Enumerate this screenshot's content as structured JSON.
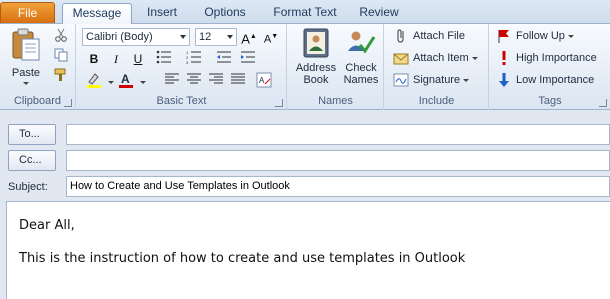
{
  "tabs": [
    "File",
    "Message",
    "Insert",
    "Options",
    "Format Text",
    "Review"
  ],
  "clipboard": {
    "paste": "Paste",
    "label": "Clipboard"
  },
  "basic_text": {
    "font": "Calibri (Body)",
    "size": "12",
    "bold": "B",
    "italic": "I",
    "underline": "U",
    "label": "Basic Text"
  },
  "names": {
    "address_book": "Address Book",
    "check_names": "Check Names",
    "label": "Names"
  },
  "include": {
    "attach_file": "Attach File",
    "attach_item": "Attach Item",
    "signature": "Signature",
    "label": "Include"
  },
  "tags": {
    "follow_up": "Follow Up",
    "high_importance": "High Importance",
    "low_importance": "Low Importance",
    "label": "Tags"
  },
  "fields": {
    "to_label": "To...",
    "cc_label": "Cc...",
    "subject_label": "Subject:",
    "to_value": "",
    "cc_value": "",
    "subject_value": "How to Create and Use Templates in Outlook"
  },
  "body": {
    "line1": "Dear All,",
    "line2": "This is the instruction of how to create and use templates in Outlook"
  },
  "colors": {
    "file_tab": "#d86e10",
    "highlight": "#ffff00",
    "font_color": "#d00000",
    "flag": "#d00000",
    "high_importance": "#d00000",
    "low_importance": "#1e5fc6"
  }
}
